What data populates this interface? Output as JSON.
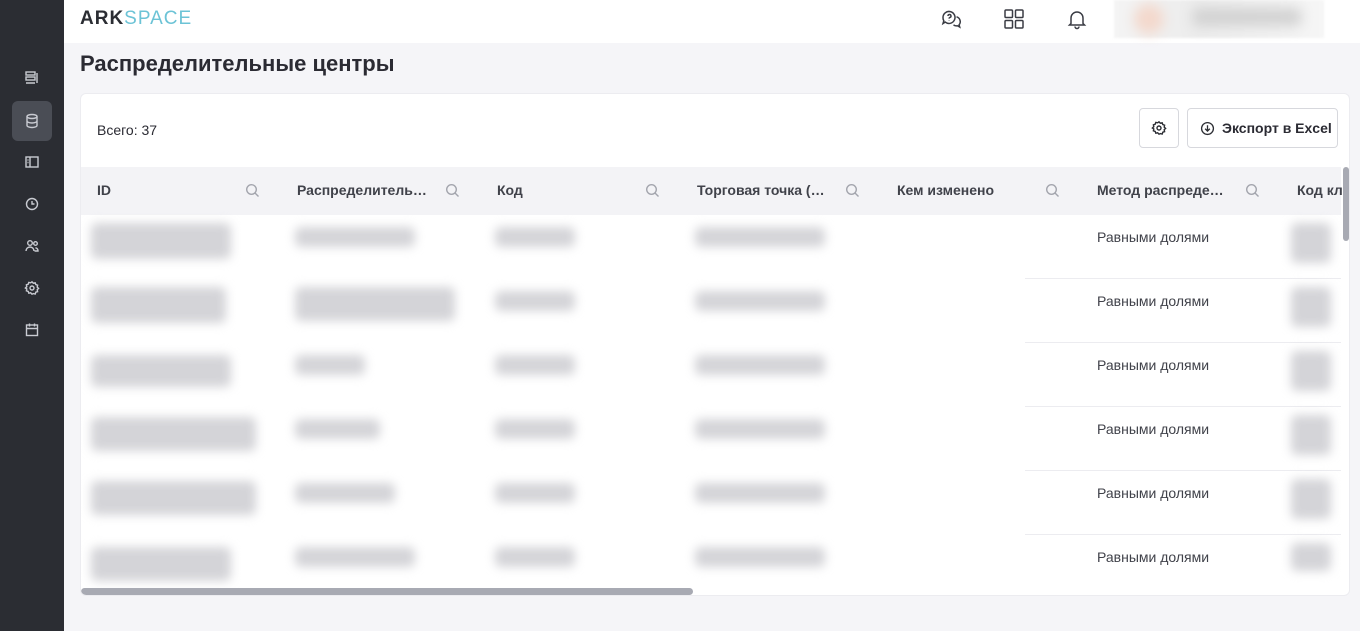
{
  "app": {
    "logo_part1": "ARK",
    "logo_part2": "SPACE",
    "accent_color": "#6cc3d6",
    "sidebar_color": "#2b2d33"
  },
  "sidebar": {
    "items": [
      {
        "icon": "list-icon",
        "active": false
      },
      {
        "icon": "database-icon",
        "active": true
      },
      {
        "icon": "book-icon",
        "active": false
      },
      {
        "icon": "clock-icon",
        "active": false
      },
      {
        "icon": "users-icon",
        "active": false
      },
      {
        "icon": "gear-icon",
        "active": false
      },
      {
        "icon": "calendar-icon",
        "active": false
      }
    ]
  },
  "topbar": {
    "icons": [
      "help-chat-icon",
      "apps-grid-icon",
      "bell-icon"
    ]
  },
  "page": {
    "title": "Распределительные центры"
  },
  "toolbar": {
    "total_label": "Всего: 37",
    "export_label": "Экспорт в Excel"
  },
  "table": {
    "columns": [
      {
        "label": "ID"
      },
      {
        "label": "Распределительный центр"
      },
      {
        "label": "Код"
      },
      {
        "label": "Торговая точка (основная)"
      },
      {
        "label": "Кем изменено"
      },
      {
        "label": "Метод распределения"
      },
      {
        "label": "Код кл"
      }
    ],
    "rows": [
      {
        "method": "Равными долями"
      },
      {
        "method": "Равными долями"
      },
      {
        "method": "Равными долями"
      },
      {
        "method": "Равными долями"
      },
      {
        "method": "Равными долями"
      },
      {
        "method": "Равными долями"
      }
    ]
  }
}
